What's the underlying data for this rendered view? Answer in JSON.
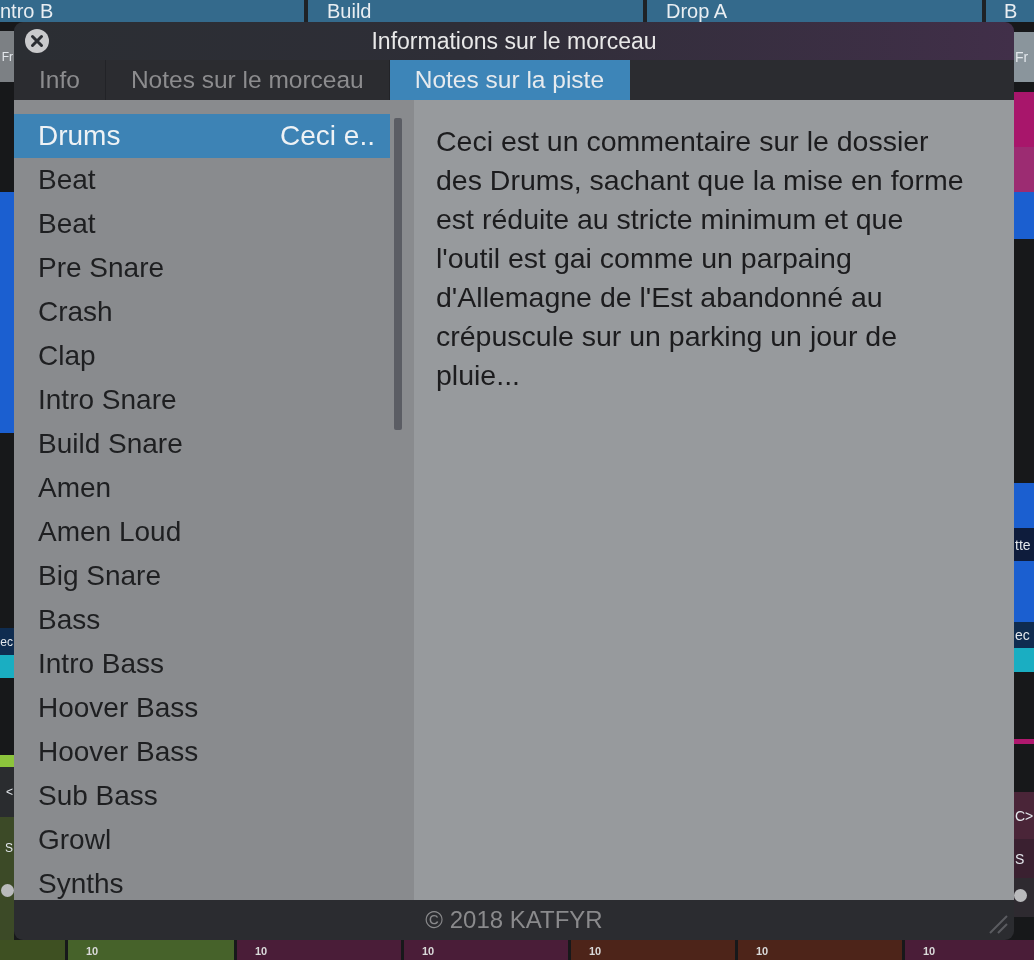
{
  "arrangement": {
    "markers": [
      {
        "label": "ntro B"
      },
      {
        "label": "Build"
      },
      {
        "label": "Drop A"
      },
      {
        "label": "B"
      }
    ],
    "left_edge": [
      {
        "kind": "label",
        "text": "Fr",
        "color": "#7c8084"
      },
      {
        "kind": "clip",
        "color": "#1b5fd0"
      },
      {
        "kind": "label",
        "text": "ec",
        "color": "#0f2c50"
      },
      {
        "kind": "clip",
        "color": "#1aaec2"
      },
      {
        "kind": "bar",
        "color": "#8cc43c"
      },
      {
        "kind": "label",
        "text": "<",
        "color": "#2a2c2f"
      },
      {
        "kind": "label",
        "text": "S",
        "color": "#3c4a27"
      },
      {
        "kind": "knob",
        "color": "#3c4a27"
      }
    ],
    "right_edge": [
      {
        "kind": "label",
        "text": "Fr",
        "color": "#8a959c"
      },
      {
        "kind": "clip",
        "color": "#a8166b"
      },
      {
        "kind": "clip",
        "color": "#9c2c72"
      },
      {
        "kind": "clip",
        "color": "#1b5fd0"
      },
      {
        "kind": "clip",
        "color": "#1b5fd0"
      },
      {
        "kind": "label",
        "text": "tte",
        "color": "#0e1c3c"
      },
      {
        "kind": "clip",
        "color": "#1b5fd0"
      },
      {
        "kind": "label",
        "text": "ec",
        "color": "#0f2c50"
      },
      {
        "kind": "clip",
        "color": "#1aaec2"
      },
      {
        "kind": "bar",
        "color": "#b0186e"
      },
      {
        "kind": "label",
        "text": "C>",
        "color": "#4a2538"
      },
      {
        "kind": "label",
        "text": "S",
        "color": "#3a2030"
      },
      {
        "kind": "knob",
        "color": "#2e2a30"
      }
    ]
  },
  "mixer": {
    "channels": [
      {
        "color": "#3e5022"
      },
      {
        "label": "10",
        "color": "#46622a"
      },
      {
        "label": "10",
        "color": "#4a1d38"
      },
      {
        "label": "10",
        "color": "#4a1d38"
      },
      {
        "label": "10",
        "color": "#4d2419"
      },
      {
        "label": "10",
        "color": "#4d2419"
      },
      {
        "label": "10",
        "color": "#4a1d38"
      }
    ]
  },
  "dialog": {
    "title": "Informations sur le morceau",
    "tabs": [
      {
        "label": "Info",
        "selected": false
      },
      {
        "label": "Notes sur le morceau",
        "selected": false
      },
      {
        "label": "Notes sur la piste",
        "selected": true
      }
    ],
    "tracks": [
      {
        "name": "Drums",
        "note": "Ceci e..",
        "selected": true
      },
      {
        "name": "Beat",
        "selected": false
      },
      {
        "name": "Beat",
        "selected": false
      },
      {
        "name": "Pre Snare",
        "selected": false
      },
      {
        "name": "Crash",
        "selected": false
      },
      {
        "name": "Clap",
        "selected": false
      },
      {
        "name": "Intro Snare",
        "selected": false
      },
      {
        "name": "Build Snare",
        "selected": false
      },
      {
        "name": "Amen",
        "selected": false
      },
      {
        "name": "Amen Loud",
        "selected": false
      },
      {
        "name": "Big Snare",
        "selected": false
      },
      {
        "name": "Bass",
        "selected": false
      },
      {
        "name": "Intro Bass",
        "selected": false
      },
      {
        "name": "Hoover Bass",
        "selected": false
      },
      {
        "name": "Hoover Bass",
        "selected": false
      },
      {
        "name": "Sub Bass",
        "selected": false
      },
      {
        "name": "Growl",
        "selected": false
      },
      {
        "name": "Synths",
        "selected": false
      }
    ],
    "note_text": "Ceci est un commentaire sur le dossier des Drums, sachant que la mise en forme est réduite au stricte minimum et que l'outil est gai comme un parpaing d'Allemagne de l'Est abandonné au crépuscule sur un parking un jour de pluie...",
    "footer": "© 2018 KATFYR"
  }
}
